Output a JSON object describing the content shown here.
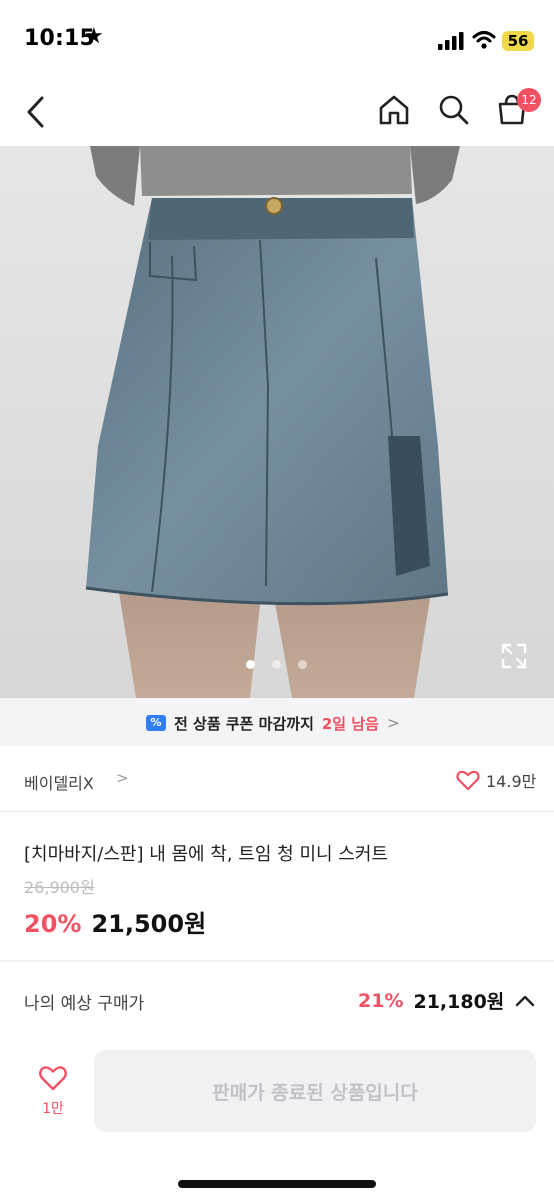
{
  "status_bar": {
    "time": "10:15",
    "star": "★",
    "battery": "56"
  },
  "nav": {
    "cart_count": "12",
    "icons": [
      "back-icon",
      "home-icon",
      "search-icon",
      "cart-icon"
    ]
  },
  "gallery": {
    "image": "denim mini skirt product photo",
    "page_count": 3,
    "active_index": 0
  },
  "coupon_banner": {
    "text": "전 상품 쿠폰 마감까지",
    "highlight": "2일 남음",
    "chevron": ">"
  },
  "brand": {
    "name": "베이델리X",
    "arrow": ">",
    "likes": "14.9만"
  },
  "product": {
    "title": "[치마바지/스판] 내 몸에 착, 트임 청 미니 스커트",
    "original_price": "26,900원",
    "discount": "20%",
    "price": "21,500원"
  },
  "expected_price": {
    "label": "나의 예상 구매가",
    "discount": "21%",
    "price": "21,180원"
  },
  "bottom_bar": {
    "wish_count": "1만",
    "buy_label": "판매가 종료된 상품입니다"
  },
  "colors": {
    "accent": "#f05264",
    "coupon_tag": "#2f7ef5",
    "battery": "#f1d84a",
    "disabled_button": "#f1f1f3"
  }
}
